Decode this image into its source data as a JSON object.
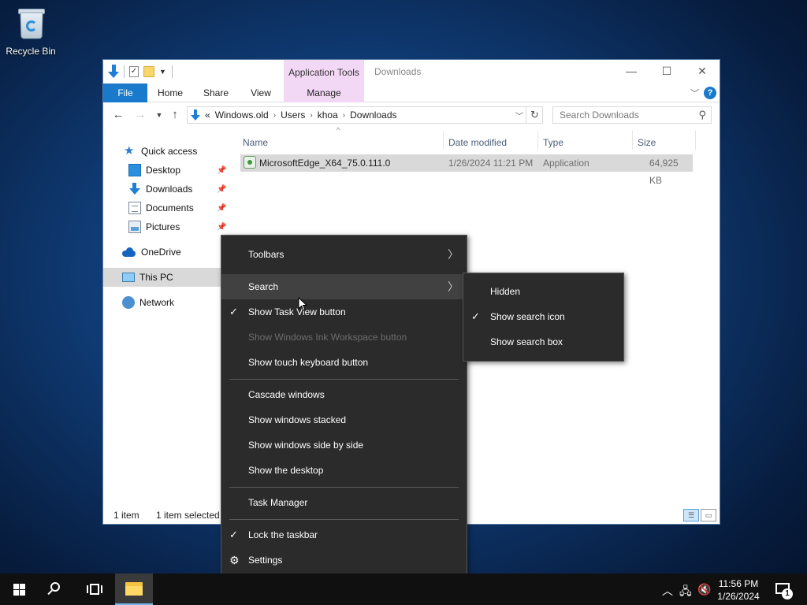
{
  "desktop": {
    "recycle_bin_label": "Recycle Bin"
  },
  "window": {
    "title": "Downloads",
    "context_tab_group": "Application Tools",
    "ribbon_tabs": [
      "File",
      "Home",
      "Share",
      "View",
      "Manage"
    ],
    "breadcrumb_prefix": "«",
    "breadcrumb": [
      "Windows.old",
      "Users",
      "khoa",
      "Downloads"
    ],
    "search_placeholder": "Search Downloads",
    "nav": {
      "quick_access": "Quick access",
      "desktop": "Desktop",
      "downloads": "Downloads",
      "documents": "Documents",
      "pictures": "Pictures",
      "onedrive": "OneDrive",
      "this_pc": "This PC",
      "network": "Network"
    },
    "columns": {
      "name": "Name",
      "date_modified": "Date modified",
      "type": "Type",
      "size": "Size"
    },
    "files": [
      {
        "name": "MicrosoftEdge_X64_75.0.111.0",
        "date_modified": "1/26/2024 11:21 PM",
        "type": "Application",
        "size": "64,925 KB"
      }
    ],
    "status": {
      "count": "1 item",
      "selected": "1 item selected"
    }
  },
  "taskbar_menu": {
    "items": {
      "toolbars": "Toolbars",
      "search": "Search",
      "show_task_view": "Show Task View button",
      "show_ink_workspace": "Show Windows Ink Workspace button",
      "show_touch_keyboard": "Show touch keyboard button",
      "cascade": "Cascade windows",
      "stacked": "Show windows stacked",
      "side_by_side": "Show windows side by side",
      "show_desktop": "Show the desktop",
      "task_manager": "Task Manager",
      "lock_taskbar": "Lock the taskbar",
      "settings": "Settings"
    }
  },
  "search_submenu": {
    "items": {
      "hidden": "Hidden",
      "show_icon": "Show search icon",
      "show_box": "Show search box"
    }
  },
  "taskbar": {
    "time": "11:56 PM",
    "date": "1/26/2024",
    "notification_count": "1"
  }
}
